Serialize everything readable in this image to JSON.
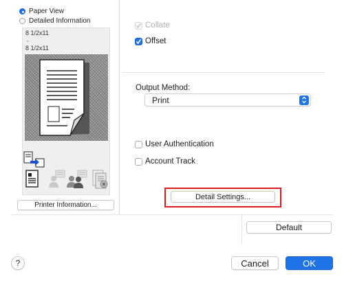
{
  "view_mode": {
    "options": [
      {
        "label": "Paper View",
        "selected": true
      },
      {
        "label": "Detailed Information",
        "selected": false
      }
    ]
  },
  "preview": {
    "original_size": "8 1/2x11",
    "output_size": "8 1/2x11",
    "chevron": "⌄",
    "icons": [
      "document-to-printer-icon",
      "document-icon",
      "user-authentication-icon",
      "account-track-icon",
      "secure-print-icon"
    ]
  },
  "printer_info_button": "Printer Information...",
  "finishing": {
    "collate": {
      "label": "Collate",
      "checked": true,
      "enabled": false
    },
    "offset": {
      "label": "Offset",
      "checked": true,
      "enabled": true
    }
  },
  "output_method": {
    "label": "Output Method:",
    "value": "Print"
  },
  "authentication": {
    "user_authentication": {
      "label": "User Authentication",
      "checked": false
    },
    "account_track": {
      "label": "Account Track",
      "checked": false
    }
  },
  "detail_settings_button": "Detail Settings...",
  "default_button": "Default",
  "footer": {
    "help": "?",
    "cancel": "Cancel",
    "ok": "OK"
  },
  "colors": {
    "accent": "#1f73e6",
    "highlight_border": "#e0191c"
  }
}
